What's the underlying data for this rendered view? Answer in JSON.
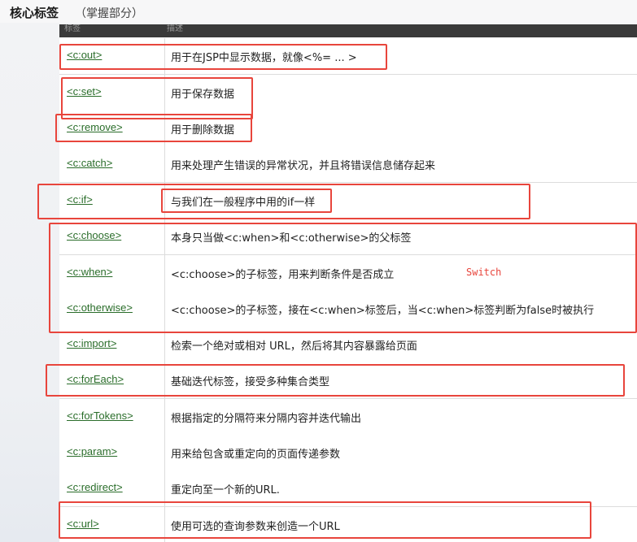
{
  "title": {
    "main": "核心标签",
    "sub": "（掌握部分）"
  },
  "table": {
    "headers": [
      "标签",
      "描述"
    ],
    "rows": [
      {
        "tag": "<c:out>",
        "desc": "用于在JSP中显示数据，就像<%= ... >"
      },
      {
        "tag": "<c:set>",
        "desc": "用于保存数据"
      },
      {
        "tag": "<c:remove>",
        "desc": "用于删除数据"
      },
      {
        "tag": "<c:catch>",
        "desc": "用来处理产生错误的异常状况，并且将错误信息储存起来"
      },
      {
        "tag": "<c:if>",
        "desc": "与我们在一般程序中用的if一样"
      },
      {
        "tag": "<c:choose>",
        "desc": "本身只当做<c:when>和<c:otherwise>的父标签"
      },
      {
        "tag": "<c:when>",
        "desc": "<c:choose>的子标签，用来判断条件是否成立"
      },
      {
        "tag": "<c:otherwise>",
        "desc": "<c:choose>的子标签，接在<c:when>标签后，当<c:when>标签判断为false时被执行"
      },
      {
        "tag": "<c:import>",
        "desc": "检索一个绝对或相对 URL，然后将其内容暴露给页面"
      },
      {
        "tag": "<c:forEach>",
        "desc": "基础迭代标签，接受多种集合类型"
      },
      {
        "tag": "<c:forTokens>",
        "desc": "根据指定的分隔符来分隔内容并迭代输出"
      },
      {
        "tag": "<c:param>",
        "desc": "用来给包含或重定向的页面传递参数"
      },
      {
        "tag": "<c:redirect>",
        "desc": "重定向至一个新的URL."
      },
      {
        "tag": "<c:url>",
        "desc": "使用可选的查询参数来创造一个URL"
      }
    ]
  },
  "annotation": {
    "switch_note": "Switch",
    "color": "#e8453c"
  },
  "colors": {
    "link": "#2a6d2a",
    "header_bg": "#3a3a3a"
  }
}
